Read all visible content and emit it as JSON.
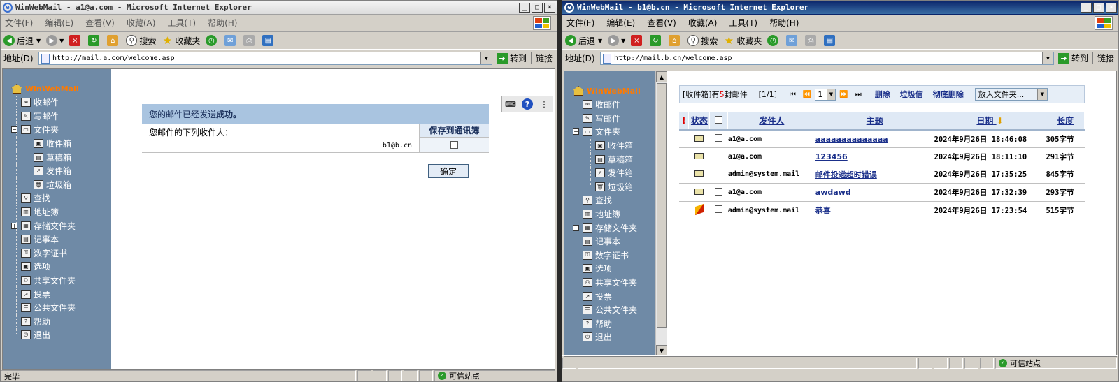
{
  "window1": {
    "title": "WinWebMail - a1@a.com - Microsoft Internet Explorer",
    "menu": [
      "文件(F)",
      "编辑(E)",
      "查看(V)",
      "收藏(A)",
      "工具(T)",
      "帮助(H)"
    ],
    "toolbar": {
      "back": "后退",
      "search": "搜索",
      "favorites": "收藏夹"
    },
    "address_label": "地址(D)",
    "address_url": "http://mail.a.com/welcome.asp",
    "go_label": "转到",
    "links_label": "链接",
    "status_text": "完毕",
    "status_zone": "可信站点"
  },
  "window2": {
    "title": "WinWebMail - b1@b.cn - Microsoft Internet Explorer",
    "menu": [
      "文件(F)",
      "编辑(E)",
      "查看(V)",
      "收藏(A)",
      "工具(T)",
      "帮助(H)"
    ],
    "toolbar": {
      "back": "后退",
      "search": "搜索",
      "favorites": "收藏夹"
    },
    "address_label": "地址(D)",
    "address_url": "http://mail.b.cn/welcome.asp",
    "go_label": "转到",
    "links_label": "链接",
    "status_zone": "可信站点"
  },
  "nav": {
    "brand": "WinWebMail",
    "items": [
      "收邮件",
      "写邮件",
      "文件夹",
      "收件箱",
      "草稿箱",
      "发件箱",
      "垃圾箱",
      "查找",
      "地址簿",
      "存储文件夹",
      "记事本",
      "数字证书",
      "选项",
      "共享文件夹",
      "投票",
      "公共文件夹",
      "帮助",
      "退出"
    ]
  },
  "sent": {
    "message_prefix": "您的邮件已经发送",
    "message_bold": "成功。",
    "recipients_label": "您邮件的下列收件人：",
    "recipient": "b1@b.cn",
    "save_header": "保存到通讯簿",
    "ok_label": "确定"
  },
  "inbox": {
    "folder_prefix": "[收件箱]有",
    "count": "5",
    "count_suffix": "封邮件",
    "pages": "[1/1]",
    "page_value": "1",
    "delete_label": "删除",
    "junk_label": "垃圾信",
    "purge_label": "彻底删除",
    "move_label": "放入文件夹...",
    "columns": {
      "flag": "!",
      "status": "状态",
      "sender": "发件人",
      "subject": "主题",
      "date": "日期",
      "length": "长度"
    },
    "rows": [
      {
        "status": "envelope",
        "sender": "a1@a.com",
        "subject": "aaaaaaaaaaaaaa",
        "date": "2024年9月26日 18:46:08",
        "length": "305字节"
      },
      {
        "status": "envelope",
        "sender": "a1@a.com",
        "subject": "123456",
        "date": "2024年9月26日 18:11:10",
        "length": "291字节"
      },
      {
        "status": "envelope",
        "sender": "admin@system.mail",
        "subject": "邮件投递超时错误",
        "date": "2024年9月26日 17:35:25",
        "length": "845字节"
      },
      {
        "status": "envelope",
        "sender": "a1@a.com",
        "subject": "awdawd",
        "date": "2024年9月26日 17:32:39",
        "length": "293字节"
      },
      {
        "status": "flag",
        "sender": "admin@system.mail",
        "subject": "恭喜",
        "date": "2024年9月26日 17:23:54",
        "length": "515字节"
      }
    ]
  },
  "colors": {
    "nav_bg": "#6f8aa6",
    "brand": "#ff7a00",
    "header_bg": "#a9c4e0",
    "link": "#1a2f8a"
  }
}
